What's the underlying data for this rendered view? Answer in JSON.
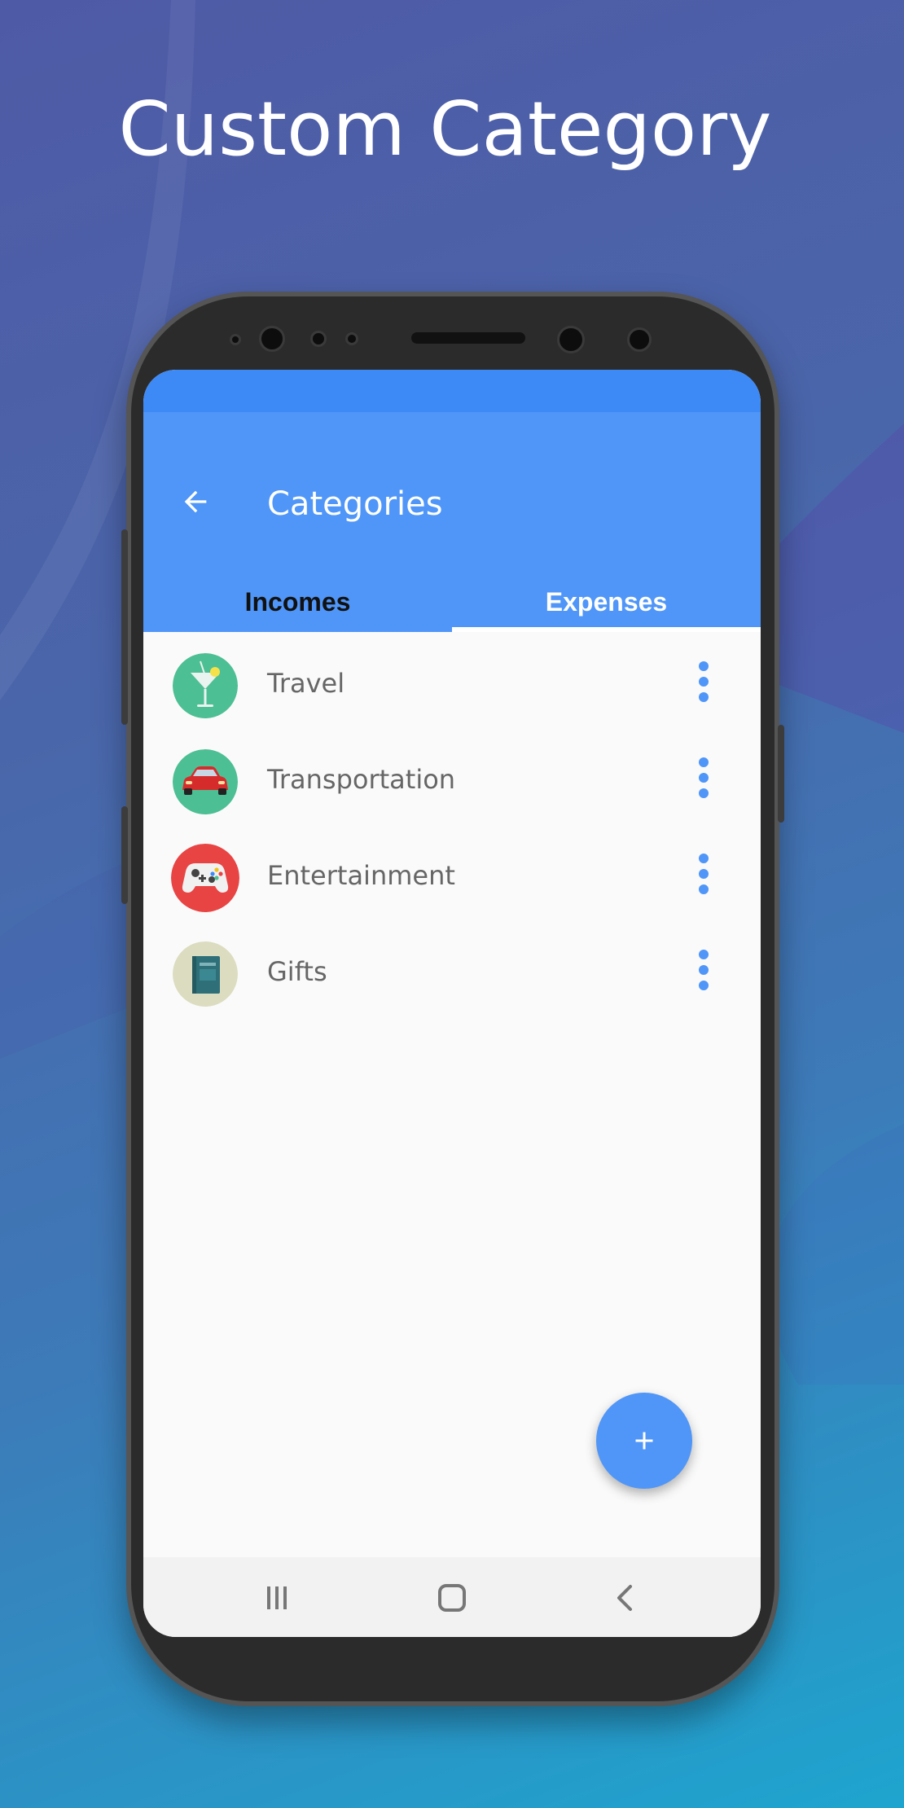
{
  "headline": "Custom Category",
  "app_bar": {
    "title": "Categories",
    "back_icon": "arrow-left-icon"
  },
  "tabs": [
    {
      "label": "Incomes",
      "selected": false
    },
    {
      "label": "Expenses",
      "selected": true
    }
  ],
  "categories": [
    {
      "label": "Travel",
      "icon": "cocktail-icon",
      "icon_bg": "#4dbf94"
    },
    {
      "label": "Transportation",
      "icon": "car-icon",
      "icon_bg": "#4dbf94"
    },
    {
      "label": "Entertainment",
      "icon": "gamepad-icon",
      "icon_bg": "#e84444"
    },
    {
      "label": "Gifts",
      "icon": "book-icon",
      "icon_bg": "#dcdcc0"
    }
  ],
  "fab": {
    "icon": "plus-icon"
  },
  "nav_bar": [
    "recents-icon",
    "home-icon",
    "back-icon"
  ],
  "colors": {
    "primary": "#4f96f8",
    "status_bar": "#3d8af7",
    "text_secondary": "#666666"
  }
}
